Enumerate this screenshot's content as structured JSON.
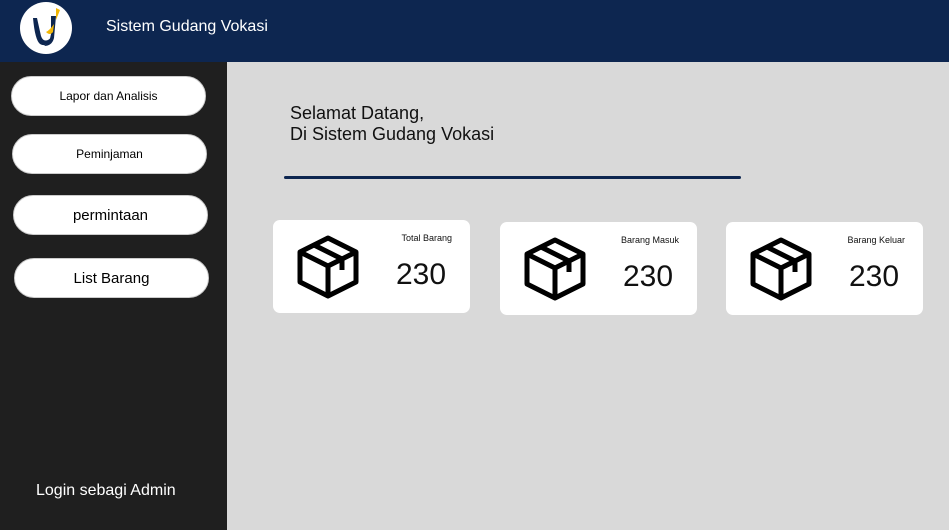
{
  "header": {
    "app_title": "Sistem Gudang Vokasi"
  },
  "sidebar": {
    "items": [
      {
        "label": "Lapor dan Analisis"
      },
      {
        "label": "Peminjaman"
      },
      {
        "label": "permintaan"
      },
      {
        "label": "List Barang"
      }
    ],
    "login_text": "Login sebagi Admin"
  },
  "main": {
    "welcome_line1": "Selamat Datang,",
    "welcome_line2": "Di Sistem Gudang Vokasi",
    "cards": [
      {
        "label": "Total Barang",
        "value": "230"
      },
      {
        "label": "Barang Masuk",
        "value": "230"
      },
      {
        "label": "Barang Keluar",
        "value": "230"
      }
    ]
  },
  "colors": {
    "header": "#0d2650",
    "sidebar": "#1f1f1f",
    "main_bg": "#d9d9d9",
    "logo_blue": "#0d2650",
    "logo_gold": "#f2b705"
  },
  "icons": {
    "logo": "uv-logo",
    "card_icon": "package-box-icon"
  }
}
